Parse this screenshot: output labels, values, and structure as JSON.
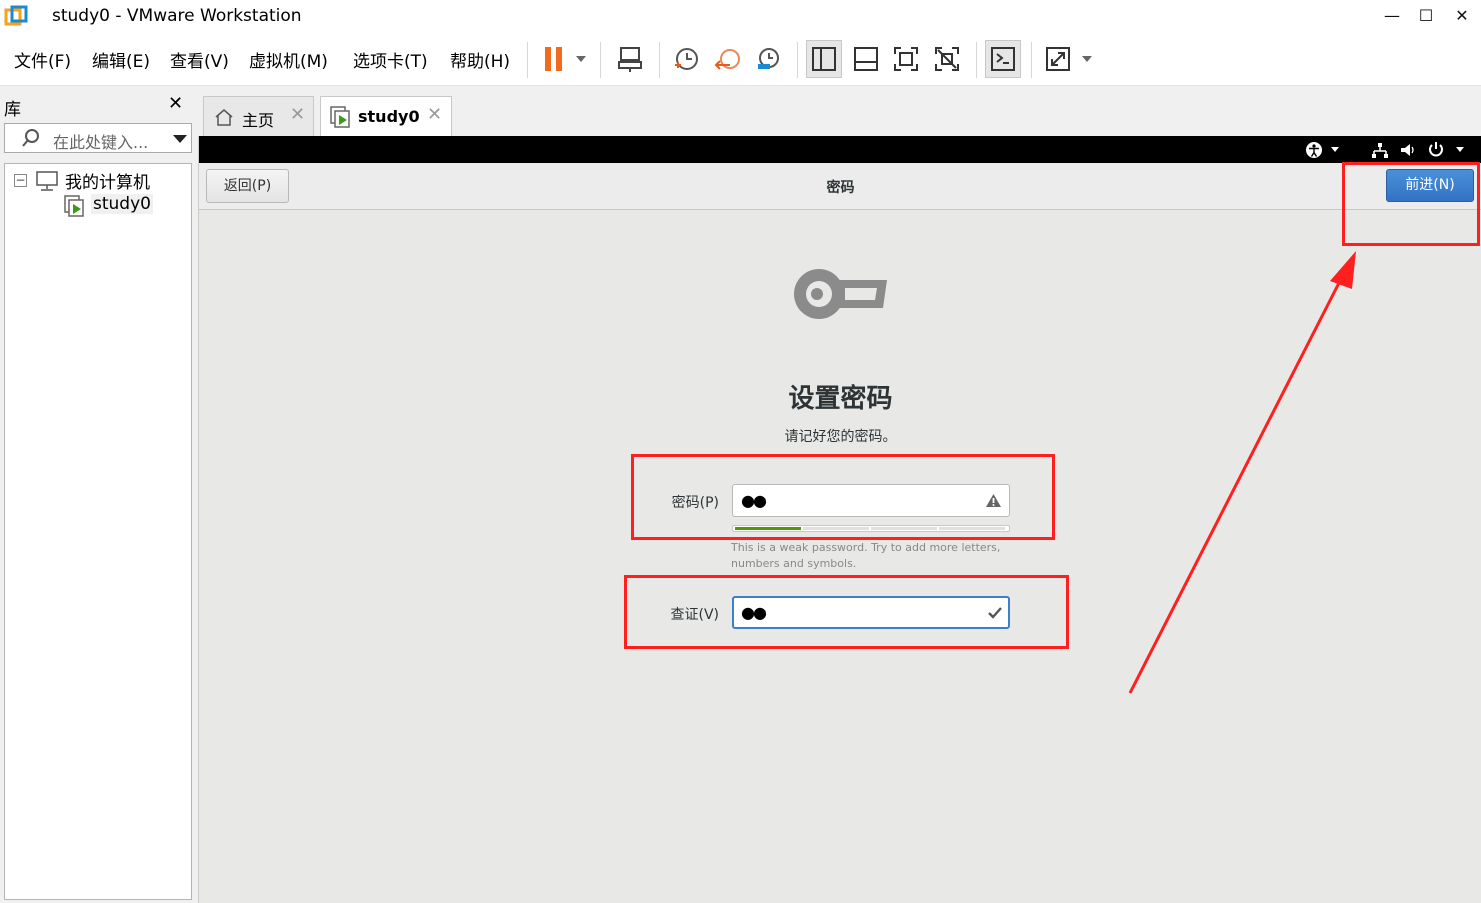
{
  "window": {
    "title": "study0 - VMware Workstation"
  },
  "menu": [
    "文件(F)",
    "编辑(E)",
    "查看(V)",
    "虚拟机(M)",
    "选项卡(T)",
    "帮助(H)"
  ],
  "library": {
    "title": "库",
    "search_placeholder": "在此处键入...",
    "tree": {
      "root": "我的计算机",
      "child": "study0"
    }
  },
  "tabs": [
    {
      "label": "主页"
    },
    {
      "label": "study0"
    }
  ],
  "installer": {
    "back_label": "返回(P)",
    "header_title": "密码",
    "next_label": "前进(N)",
    "heading": "设置密码",
    "subheading": "请记好您的密码。",
    "password_label": "密码(P)",
    "password_value": "●●",
    "confirm_label": "查证(V)",
    "confirm_value": "●●",
    "strength_fraction": 0.25,
    "hint": "This is a weak password. Try to add more letters, numbers and symbols."
  },
  "colors": {
    "accent": "#3372c4",
    "annotation": "#ff1f1f",
    "strength": "#4e9a06"
  }
}
